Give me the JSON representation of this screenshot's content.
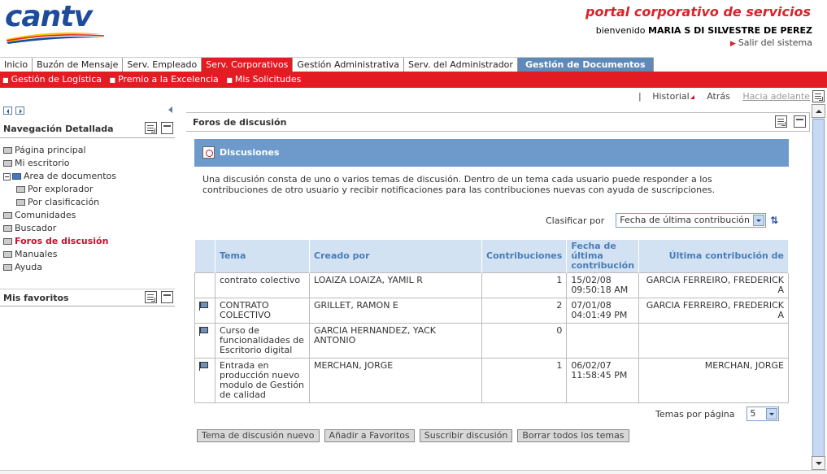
{
  "header": {
    "logo_text": "cantv",
    "portal_title": "portal corporativo de servicios",
    "welcome_prefix": "bienvenido",
    "user_name": "MARIA S DI SILVESTRE DE PEREZ",
    "logout_label": "Salir del sistema"
  },
  "topnav": {
    "tabs": [
      {
        "label": "Inicio"
      },
      {
        "label": "Buzón de Mensaje"
      },
      {
        "label": "Serv. Empleado"
      },
      {
        "label": "Serv. Corporativos"
      },
      {
        "label": "Gestión Administrativa"
      },
      {
        "label": "Serv. del Administrador"
      },
      {
        "label": "Gestión de Documentos"
      }
    ]
  },
  "subnav": {
    "items": [
      {
        "label": "Gestión de Logística"
      },
      {
        "label": "Premio a la Excelencia"
      },
      {
        "label": "Mis Solicitudes"
      }
    ]
  },
  "history": {
    "historial": "Historial",
    "back": "Atrás",
    "forward": "Hacia adelante"
  },
  "sidebar": {
    "nav_title": "Navegación Detallada",
    "items": [
      {
        "label": "Página principal"
      },
      {
        "label": "Mi escritorio"
      },
      {
        "label": "Area de documentos"
      },
      {
        "label": "Por explorador"
      },
      {
        "label": "Por clasificación"
      },
      {
        "label": "Comunidades"
      },
      {
        "label": "Buscador"
      },
      {
        "label": "Foros de discusión"
      },
      {
        "label": "Manuales"
      },
      {
        "label": "Ayuda"
      }
    ],
    "favorites_title": "Mis favoritos"
  },
  "main": {
    "portlet_title": "Foros de discusión",
    "section_title": "Discusiones",
    "description": "Una discusión consta de uno o varios temas de discusión. Dentro de un tema cada usuario puede responder a los contribuciones de otro usuario y recibir notificaciones para las contribuciones nuevas con ayuda de suscripciones.",
    "sort_label": "Clasificar por",
    "sort_value": "Fecha de última contribución",
    "columns": {
      "tema": "Tema",
      "creado_por": "Creado por",
      "contribuciones": "Contribuciones",
      "fecha": "Fecha de última contribución",
      "ultima": "Última contribución de"
    },
    "rows": [
      {
        "flag": false,
        "tema": "contrato colectivo",
        "creado_por": "LOAIZA LOAIZA, YAMIL R",
        "contribuciones": "1",
        "fecha": "15/02/08 09:50:18 AM",
        "ultima": "GARCIA FERREIRO, FREDERICK A"
      },
      {
        "flag": true,
        "tema": "CONTRATO COLECTIVO",
        "creado_por": "GRILLET, RAMON E",
        "contribuciones": "2",
        "fecha": "07/01/08 04:01:49 PM",
        "ultima": "GARCIA FERREIRO, FREDERICK A"
      },
      {
        "flag": true,
        "tema": "Curso de funcionalidades de Escritorio digital",
        "creado_por": "GARCIA HERNANDEZ, YACK ANTONIO",
        "contribuciones": "0",
        "fecha": "",
        "ultima": ""
      },
      {
        "flag": true,
        "tema": "Entrada en producción nuevo modulo de Gestión de calidad",
        "creado_por": "MERCHAN, JORGE",
        "contribuciones": "1",
        "fecha": "06/02/07 11:58:45 PM",
        "ultima": "MERCHAN, JORGE"
      }
    ],
    "per_page_label": "Temas por página",
    "per_page_value": "5",
    "buttons": {
      "new_topic": "Tema de discusión nuevo",
      "add_fav": "Añadir a Favoritos",
      "subscribe": "Suscribir discusión",
      "delete_all": "Borrar todos los temas"
    }
  },
  "colors": {
    "brand_red": "#e31b23",
    "brand_blue": "#1d4c9c",
    "active_tab_blue": "#5d8ab9",
    "section_bar": "#6d9acb",
    "table_header": "#d3e2f2"
  }
}
